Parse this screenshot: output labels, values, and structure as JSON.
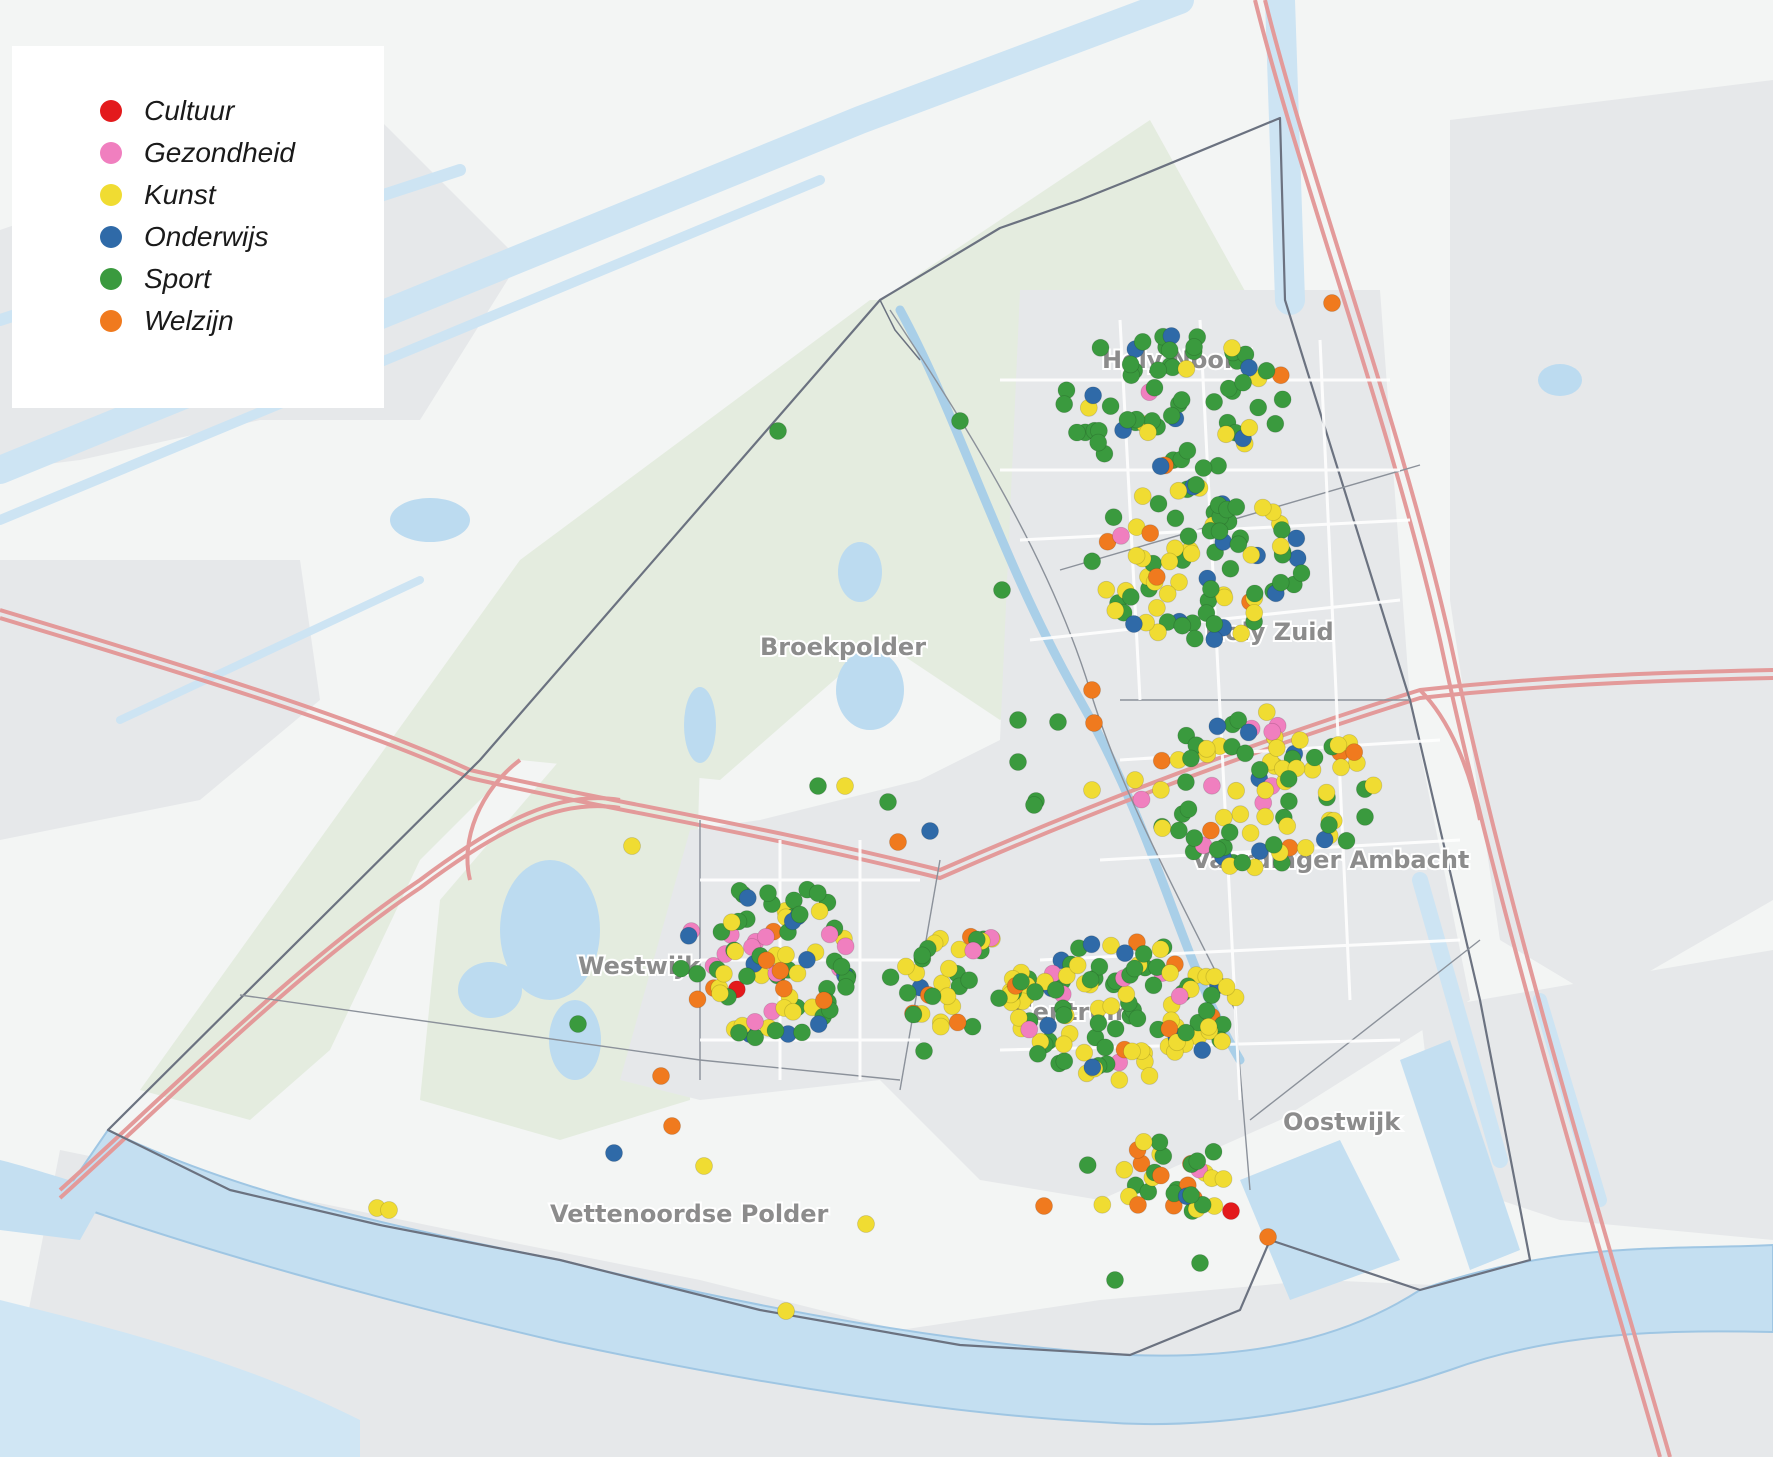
{
  "legend": {
    "items": [
      {
        "label": "Cultuur",
        "color": "#e31a1c",
        "key": "cultuur"
      },
      {
        "label": "Gezondheid",
        "color": "#f07fbf",
        "key": "gezondheid"
      },
      {
        "label": "Kunst",
        "color": "#f0dc32",
        "key": "kunst"
      },
      {
        "label": "Onderwijs",
        "color": "#2f6aa8",
        "key": "onderwijs"
      },
      {
        "label": "Sport",
        "color": "#3a9a3e",
        "key": "sport"
      },
      {
        "label": "Welzijn",
        "color": "#f07a1e",
        "key": "welzijn"
      }
    ]
  },
  "districts": {
    "holy_noord": "Holy Noord",
    "holy_zuid": "Holy Zuid",
    "broekpolder": "Broekpolder",
    "vaardinger_ambacht": "Vaardinger Ambacht",
    "westwijk": "Westwijk",
    "centrum": "Centrum",
    "oostwijk": "Oostwijk",
    "vettenoordse_polder": "Vettenoordse Polder"
  },
  "colors": {
    "land": "#f2f4f3",
    "green_area": "#e3ecdf",
    "water": "#c6e1f2",
    "highway": "#e59999",
    "boundary": "#6b7280"
  }
}
